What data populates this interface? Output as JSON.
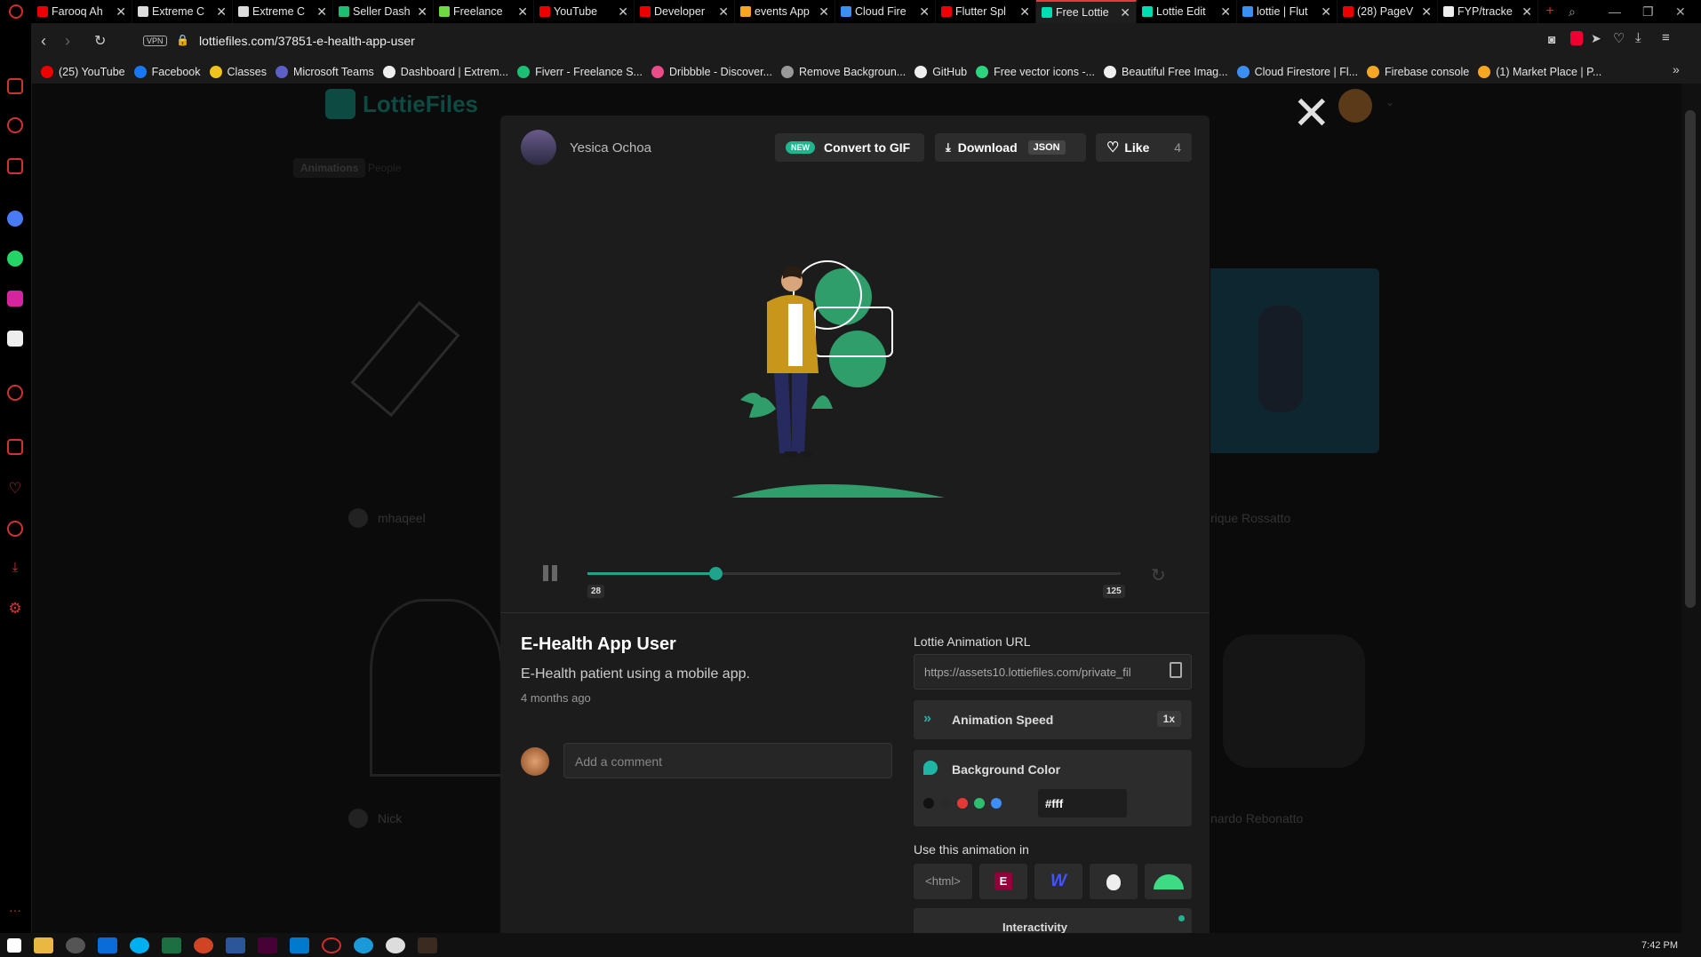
{
  "tabs": [
    {
      "title": "Farooq Ah",
      "color": "#e00"
    },
    {
      "title": "Extreme C",
      "color": "#ddd"
    },
    {
      "title": "Extreme C",
      "color": "#ddd"
    },
    {
      "title": "Seller Dash",
      "color": "#1dbf73"
    },
    {
      "title": "Freelance",
      "color": "#6fda44"
    },
    {
      "title": "YouTube",
      "color": "#e00"
    },
    {
      "title": "Developer",
      "color": "#e00"
    },
    {
      "title": "events App",
      "color": "#f5a623"
    },
    {
      "title": "Cloud Fire",
      "color": "#3b8ff3"
    },
    {
      "title": "Flutter Spl",
      "color": "#e00"
    },
    {
      "title": "Free Lottie",
      "color": "#00ddb3"
    },
    {
      "title": "Lottie Edit",
      "color": "#00ddb3"
    },
    {
      "title": "lottie | Flut",
      "color": "#3b8ff3"
    },
    {
      "title": "(28) PageV",
      "color": "#e00"
    },
    {
      "title": "FYP/tracke",
      "color": "#eee"
    }
  ],
  "browser": {
    "url": "lottiefiles.com/37851-e-health-app-user",
    "vpn": "VPN"
  },
  "bookmarks": [
    {
      "label": "(25) YouTube",
      "color": "#e00"
    },
    {
      "label": "Facebook",
      "color": "#1877f2"
    },
    {
      "label": "Classes",
      "color": "#f0c419"
    },
    {
      "label": "Microsoft Teams",
      "color": "#5b5fc7"
    },
    {
      "label": "Dashboard | Extrem...",
      "color": "#eee"
    },
    {
      "label": "Fiverr - Freelance S...",
      "color": "#1dbf73"
    },
    {
      "label": "Dribbble - Discover...",
      "color": "#ea4c89"
    },
    {
      "label": "Remove Backgroun...",
      "color": "#999"
    },
    {
      "label": "GitHub",
      "color": "#eee"
    },
    {
      "label": "Free vector icons -...",
      "color": "#2bd47d"
    },
    {
      "label": "Beautiful Free Imag...",
      "color": "#eee"
    },
    {
      "label": "Cloud Firestore | Fl...",
      "color": "#3b8ff3"
    },
    {
      "label": "Firebase console",
      "color": "#f5a623"
    },
    {
      "label": "(1) Market Place | P...",
      "color": "#f5a623"
    }
  ],
  "background": {
    "logo": "LottieFiles",
    "tab_animations": "Animations",
    "tab_people": "People",
    "card_authors": [
      "mhaqeel",
      "rique Rossatto",
      "Nick",
      "nardo Rebonatto"
    ]
  },
  "modal": {
    "author": "Yesica Ochoa",
    "badge_new": "NEW",
    "convert_label": "Convert to GIF",
    "download_label": "Download",
    "download_format": "JSON",
    "like_label": "Like",
    "like_count": "4",
    "frame_current": "28",
    "frame_total": "125",
    "progress": 0.24,
    "title": "E-Health App User",
    "description": "E-Health patient using a mobile app.",
    "time_ago": "4 months ago",
    "comment_placeholder": "Add a comment",
    "url_label": "Lottie Animation URL",
    "url_value": "https://assets10.lottiefiles.com/private_fil",
    "speed_label": "Animation Speed",
    "speed_value": "1x",
    "bg_label": "Background Color",
    "swatches": [
      "#111111",
      "#2a2a2a",
      "#e53935",
      "#2fbf71",
      "#3d8ef5"
    ],
    "bg_value": "#fff",
    "use_label": "Use this animation in",
    "platforms": [
      "<html>",
      "E",
      "W",
      "apple",
      "android"
    ],
    "interactivity_label": "Interactivity"
  },
  "clock": "7:42 PM"
}
